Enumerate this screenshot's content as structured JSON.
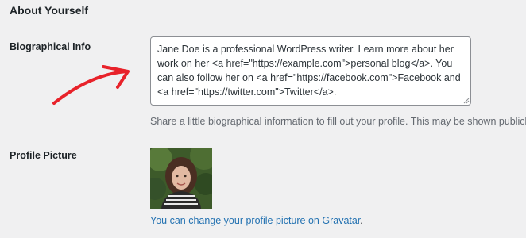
{
  "section": {
    "heading": "About Yourself"
  },
  "bio": {
    "label": "Biographical Info",
    "value": "Jane Doe is a professional WordPress writer. Learn more about her work on her <a href=\"https://example.com\">personal blog</a>. You can also follow her on <a href=\"https://facebook.com\">Facebook and <a href=\"https://twitter.com\">Twitter</a>.",
    "description": "Share a little biographical information to fill out your profile. This may be shown publicly."
  },
  "profile_picture": {
    "label": "Profile Picture",
    "gravatar_link": "You can change your profile picture on Gravatar",
    "gravatar_suffix": "."
  },
  "colors": {
    "background": "#f0f0f1",
    "link": "#2271b1",
    "annotation_arrow": "#e8222a"
  },
  "icons": {
    "annotation": "red-arrow-icon"
  }
}
